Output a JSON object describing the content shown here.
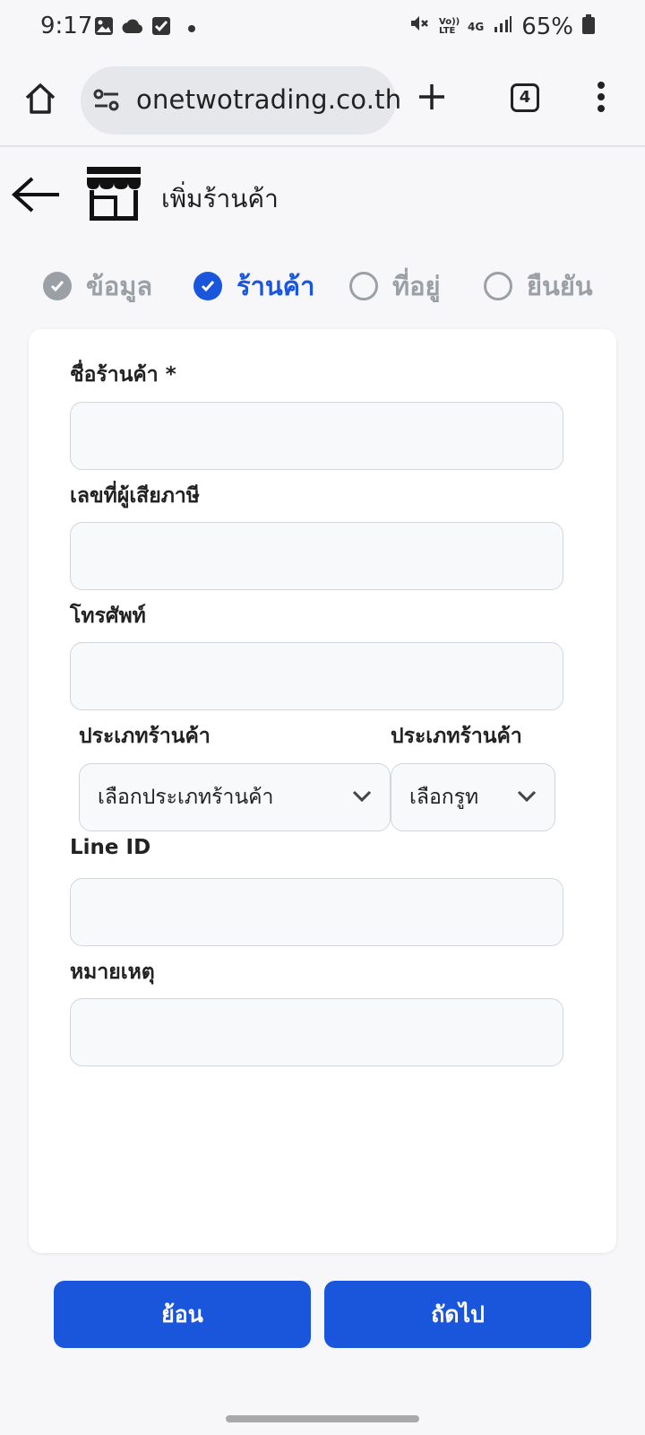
{
  "status_bar": {
    "time": "9:17",
    "battery": "65%",
    "network_label": "4G",
    "volte_label": "Vo)) LTE"
  },
  "browser": {
    "url": "onetwotrading.co.th",
    "tab_count": "4"
  },
  "header": {
    "title": "เพิ่มร้านค้า"
  },
  "stepper": {
    "steps": [
      {
        "label": "ข้อมูล",
        "state": "done"
      },
      {
        "label": "ร้านค้า",
        "state": "active"
      },
      {
        "label": "ที่อยู่",
        "state": "pending"
      },
      {
        "label": "ยืนยัน",
        "state": "pending"
      }
    ]
  },
  "form": {
    "store_name_label": "ชื่อร้านค้า *",
    "store_name_value": "",
    "tax_id_label": "เลขที่ผู้เสียภาษี",
    "tax_id_value": "",
    "phone_label": "โทรศัพท์",
    "phone_value": "",
    "store_type_label": "ประเภทร้านค้า",
    "store_type_selected": "เลือกประเภทร้านค้า",
    "store_type2_label": "ประเภทร้านค้า",
    "store_type2_selected": "เลือกรูท",
    "line_id_label": "Line ID",
    "line_id_value": "",
    "note_label": "หมายเหตุ",
    "note_value": ""
  },
  "buttons": {
    "back_label": "ย้อน",
    "next_label": "ถัดไป"
  },
  "colors": {
    "accent": "#1a56db",
    "muted": "#9aa0a6",
    "background": "#f7f7f9",
    "card": "#ffffff"
  }
}
